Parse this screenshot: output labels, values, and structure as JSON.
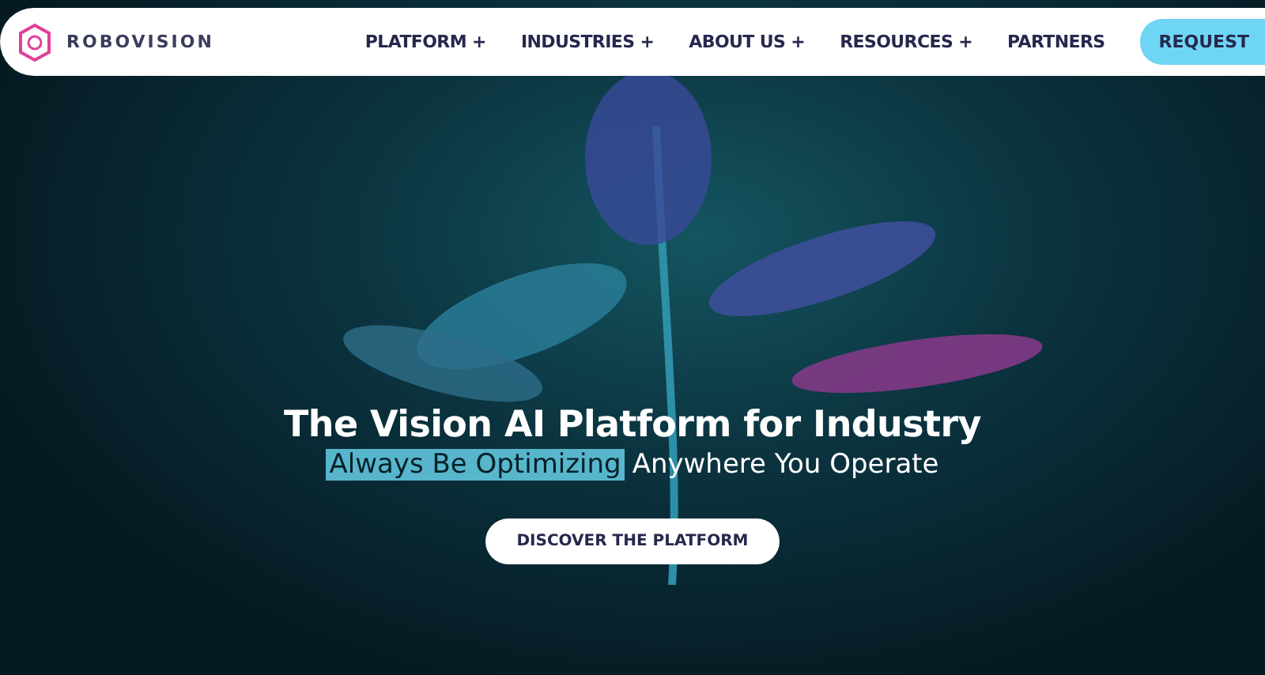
{
  "header": {
    "brand": "ROBOVISION",
    "nav": [
      {
        "label": "PLATFORM +"
      },
      {
        "label": "INDUSTRIES +"
      },
      {
        "label": "ABOUT US +"
      },
      {
        "label": "RESOURCES +"
      },
      {
        "label": "PARTNERS"
      }
    ],
    "cta": "REQUEST"
  },
  "hero": {
    "title": "The Vision AI Platform for Industry",
    "subtitle_highlight": "Always Be Optimizing",
    "subtitle_rest": "Anywhere You Operate",
    "button": "DISCOVER THE PLATFORM"
  }
}
